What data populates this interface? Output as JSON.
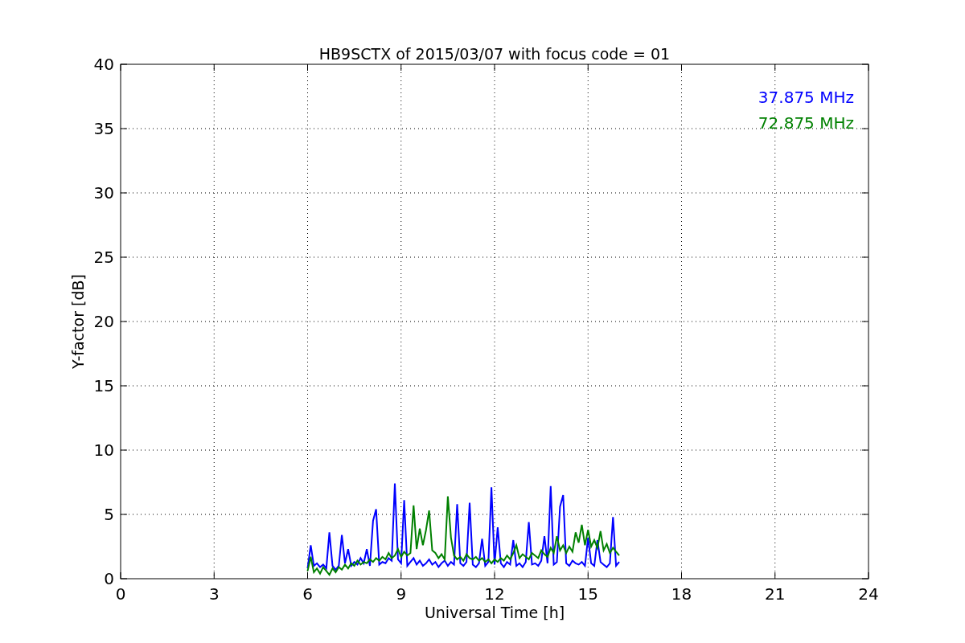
{
  "chart_data": {
    "type": "line",
    "title": "HB9SCTX of 2015/03/07 with focus code = 01",
    "xlabel": "Universal Time [h]",
    "ylabel": "Y-factor [dB]",
    "x": [
      6.0,
      6.1,
      6.2,
      6.3,
      6.4,
      6.5,
      6.6,
      6.7,
      6.8,
      6.9,
      7.0,
      7.1,
      7.2,
      7.3,
      7.4,
      7.5,
      7.6,
      7.7,
      7.8,
      7.9,
      8.0,
      8.1,
      8.2,
      8.3,
      8.4,
      8.5,
      8.6,
      8.7,
      8.8,
      8.9,
      9.0,
      9.1,
      9.2,
      9.3,
      9.4,
      9.5,
      9.6,
      9.7,
      9.8,
      9.9,
      10.0,
      10.1,
      10.2,
      10.3,
      10.4,
      10.5,
      10.6,
      10.7,
      10.8,
      10.9,
      11.0,
      11.1,
      11.2,
      11.3,
      11.4,
      11.5,
      11.6,
      11.7,
      11.8,
      11.9,
      12.0,
      12.1,
      12.2,
      12.3,
      12.4,
      12.5,
      12.6,
      12.7,
      12.8,
      12.9,
      13.0,
      13.1,
      13.2,
      13.3,
      13.4,
      13.5,
      13.6,
      13.7,
      13.8,
      13.9,
      14.0,
      14.1,
      14.2,
      14.3,
      14.4,
      14.5,
      14.6,
      14.7,
      14.8,
      14.9,
      15.0,
      15.1,
      15.2,
      15.3,
      15.4,
      15.5,
      15.6,
      15.7,
      15.8,
      15.9,
      16.0
    ],
    "series": [
      {
        "name": "37.875 MHz",
        "color": "#0000ff",
        "values": [
          0.8,
          2.6,
          1.0,
          1.2,
          0.9,
          1.1,
          0.8,
          3.6,
          1.0,
          0.7,
          1.0,
          3.4,
          1.2,
          2.3,
          1.0,
          1.3,
          1.1,
          1.6,
          1.2,
          2.3,
          1.0,
          4.5,
          5.4,
          1.1,
          1.3,
          1.2,
          1.6,
          1.4,
          7.4,
          1.5,
          1.2,
          6.1,
          1.0,
          1.3,
          1.6,
          1.1,
          1.4,
          1.0,
          1.2,
          1.5,
          1.1,
          1.3,
          0.9,
          1.2,
          1.4,
          1.0,
          1.3,
          1.1,
          5.8,
          1.2,
          1.0,
          1.3,
          5.9,
          1.1,
          0.9,
          1.2,
          3.1,
          1.0,
          1.3,
          7.1,
          1.1,
          4.0,
          1.2,
          0.9,
          1.3,
          1.1,
          3.0,
          1.0,
          1.2,
          0.9,
          1.3,
          4.4,
          1.1,
          1.2,
          1.0,
          1.4,
          3.3,
          1.2,
          7.2,
          1.1,
          1.3,
          5.6,
          6.5,
          1.2,
          1.0,
          1.4,
          1.2,
          1.1,
          1.3,
          1.0,
          3.2,
          1.2,
          1.0,
          3.0,
          1.3,
          1.1,
          0.9,
          1.2,
          4.8,
          1.0,
          1.3
        ]
      },
      {
        "name": "72.875 MHz",
        "color": "#008000",
        "values": [
          0.6,
          1.7,
          0.5,
          0.8,
          0.4,
          0.9,
          0.6,
          0.3,
          0.8,
          0.5,
          0.9,
          0.7,
          1.1,
          0.8,
          1.2,
          1.0,
          1.4,
          1.1,
          1.3,
          1.2,
          1.5,
          1.3,
          1.6,
          1.4,
          1.7,
          1.5,
          2.0,
          1.6,
          1.8,
          2.3,
          1.7,
          2.1,
          1.8,
          2.0,
          5.7,
          2.3,
          3.9,
          2.6,
          3.8,
          5.3,
          2.2,
          2.0,
          1.6,
          1.9,
          1.5,
          6.4,
          3.2,
          1.8,
          1.5,
          1.7,
          1.4,
          1.9,
          1.6,
          1.5,
          1.7,
          1.4,
          1.6,
          1.3,
          1.5,
          1.2,
          1.5,
          1.3,
          1.6,
          1.4,
          1.8,
          1.5,
          2.0,
          2.6,
          1.6,
          1.9,
          1.7,
          1.5,
          2.0,
          1.8,
          1.6,
          2.2,
          1.9,
          1.7,
          2.4,
          2.0,
          3.3,
          2.2,
          2.6,
          2.0,
          2.5,
          2.1,
          3.6,
          2.8,
          4.2,
          2.6,
          3.8,
          2.5,
          3.0,
          2.4,
          3.7,
          2.2,
          2.7,
          2.0,
          2.4,
          2.1,
          1.8
        ]
      }
    ],
    "xlim": [
      0,
      24
    ],
    "ylim": [
      0,
      40
    ],
    "grid": true,
    "xticks": [
      0,
      3,
      6,
      9,
      12,
      15,
      18,
      21,
      24
    ],
    "yticks": [
      0,
      5,
      10,
      15,
      20,
      25,
      30,
      35,
      40
    ]
  }
}
